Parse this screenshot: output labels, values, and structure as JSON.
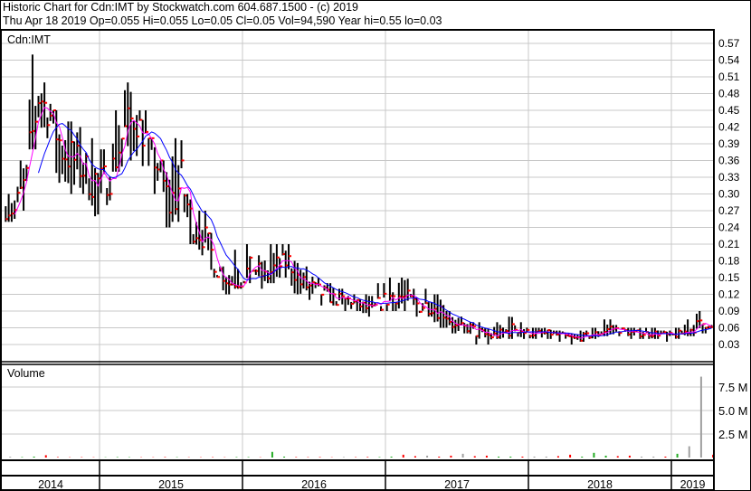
{
  "header": {
    "title": "Historic Chart for Cdn:IMT by Stockwatch.com 604.687.1500 - (c) 2019",
    "quote": "Thu Apr 18 2019  Op=0.055  Hi=0.055  Lo=0.05  Cl=0.05  Vol=94,590  Year hi=0.55  lo=0.03"
  },
  "colors": {
    "bar": "#000000",
    "close_tick": "#ff0000",
    "ma_short": "#ff00ff",
    "ma_long": "#0000ff",
    "grid": "#c8c8c8",
    "vol_up": "#22aa22",
    "vol_down": "#ff0000",
    "vol_flat": "#a0a0a0"
  },
  "chart_data": {
    "type": "bar",
    "subtype": "ohlc",
    "symbol_label": "Cdn:IMT",
    "volume_label": "Volume",
    "price_ticks": [
      "0.03",
      "0.06",
      "0.09",
      "0.12",
      "0.15",
      "0.18",
      "0.21",
      "0.24",
      "0.27",
      "0.30",
      "0.33",
      "0.36",
      "0.39",
      "0.42",
      "0.45",
      "0.48",
      "0.51",
      "0.54",
      "0.57"
    ],
    "price_ylim": [
      0.03,
      0.57
    ],
    "volume_ticks": [
      "2.5 M",
      "5.0 M",
      "7.5 M"
    ],
    "volume_ylim_millions": [
      0,
      7.5
    ],
    "years": [
      "2014",
      "2015",
      "2016",
      "2017",
      "2018",
      "2019"
    ],
    "grid": true,
    "months": [
      "2014-05",
      "2014-06",
      "2014-07",
      "2014-08",
      "2014-09",
      "2014-10",
      "2014-11",
      "2014-12",
      "2015-01",
      "2015-02",
      "2015-03",
      "2015-04",
      "2015-05",
      "2015-06",
      "2015-07",
      "2015-08",
      "2015-09",
      "2015-10",
      "2015-11",
      "2015-12",
      "2016-01",
      "2016-02",
      "2016-03",
      "2016-04",
      "2016-05",
      "2016-06",
      "2016-07",
      "2016-08",
      "2016-09",
      "2016-10",
      "2016-11",
      "2016-12",
      "2017-01",
      "2017-02",
      "2017-03",
      "2017-04",
      "2017-05",
      "2017-06",
      "2017-07",
      "2017-08",
      "2017-09",
      "2017-10",
      "2017-11",
      "2017-12",
      "2018-01",
      "2018-02",
      "2018-03",
      "2018-04",
      "2018-05",
      "2018-06",
      "2018-07",
      "2018-08",
      "2018-09",
      "2018-10",
      "2018-11",
      "2018-12",
      "2019-01",
      "2019-02",
      "2019-03",
      "2019-04"
    ],
    "hlc": [
      [
        0.3,
        0.25,
        0.27
      ],
      [
        0.36,
        0.27,
        0.33
      ],
      [
        0.55,
        0.38,
        0.48
      ],
      [
        0.5,
        0.4,
        0.44
      ],
      [
        0.45,
        0.32,
        0.38
      ],
      [
        0.43,
        0.3,
        0.36
      ],
      [
        0.42,
        0.3,
        0.34
      ],
      [
        0.4,
        0.26,
        0.32
      ],
      [
        0.38,
        0.28,
        0.33
      ],
      [
        0.45,
        0.34,
        0.4
      ],
      [
        0.5,
        0.36,
        0.44
      ],
      [
        0.45,
        0.35,
        0.4
      ],
      [
        0.4,
        0.3,
        0.35
      ],
      [
        0.36,
        0.24,
        0.28
      ],
      [
        0.4,
        0.25,
        0.32
      ],
      [
        0.3,
        0.21,
        0.24
      ],
      [
        0.27,
        0.19,
        0.22
      ],
      [
        0.23,
        0.15,
        0.17
      ],
      [
        0.17,
        0.12,
        0.14
      ],
      [
        0.2,
        0.13,
        0.15
      ],
      [
        0.21,
        0.14,
        0.17
      ],
      [
        0.19,
        0.13,
        0.15
      ],
      [
        0.21,
        0.14,
        0.17
      ],
      [
        0.21,
        0.15,
        0.18
      ],
      [
        0.18,
        0.12,
        0.14
      ],
      [
        0.17,
        0.11,
        0.13
      ],
      [
        0.15,
        0.1,
        0.12
      ],
      [
        0.14,
        0.1,
        0.11
      ],
      [
        0.13,
        0.09,
        0.11
      ],
      [
        0.12,
        0.09,
        0.1
      ],
      [
        0.12,
        0.08,
        0.09
      ],
      [
        0.14,
        0.09,
        0.11
      ],
      [
        0.15,
        0.09,
        0.12
      ],
      [
        0.15,
        0.09,
        0.11
      ],
      [
        0.13,
        0.08,
        0.1
      ],
      [
        0.13,
        0.08,
        0.1
      ],
      [
        0.12,
        0.06,
        0.09
      ],
      [
        0.09,
        0.05,
        0.06
      ],
      [
        0.08,
        0.05,
        0.06
      ],
      [
        0.07,
        0.03,
        0.05
      ],
      [
        0.06,
        0.03,
        0.045
      ],
      [
        0.07,
        0.04,
        0.05
      ],
      [
        0.08,
        0.04,
        0.06
      ],
      [
        0.07,
        0.04,
        0.05
      ],
      [
        0.06,
        0.04,
        0.05
      ],
      [
        0.06,
        0.04,
        0.05
      ],
      [
        0.055,
        0.035,
        0.045
      ],
      [
        0.05,
        0.03,
        0.04
      ],
      [
        0.055,
        0.035,
        0.045
      ],
      [
        0.06,
        0.04,
        0.05
      ],
      [
        0.075,
        0.045,
        0.06
      ],
      [
        0.065,
        0.045,
        0.055
      ],
      [
        0.06,
        0.04,
        0.05
      ],
      [
        0.06,
        0.04,
        0.05
      ],
      [
        0.06,
        0.04,
        0.05
      ],
      [
        0.055,
        0.035,
        0.045
      ],
      [
        0.06,
        0.04,
        0.05
      ],
      [
        0.075,
        0.045,
        0.06
      ],
      [
        0.09,
        0.05,
        0.07
      ],
      [
        0.065,
        0.05,
        0.05
      ]
    ],
    "volume_millions": [
      0.08,
      0.05,
      0.1,
      0.25,
      0.05,
      0.03,
      0.04,
      0.03,
      0.03,
      0.05,
      0.04,
      0.03,
      0.03,
      0.05,
      0.04,
      0.03,
      0.03,
      0.04,
      0.03,
      0.05,
      0.05,
      0.03,
      0.6,
      0.1,
      0.05,
      0.04,
      0.05,
      0.03,
      0.05,
      0.04,
      0.06,
      0.05,
      0.1,
      0.3,
      0.15,
      0.2,
      0.1,
      0.2,
      0.4,
      0.15,
      0.2,
      0.1,
      0.1,
      0.1,
      0.1,
      0.1,
      0.15,
      0.3,
      0.1,
      0.5,
      0.2,
      0.15,
      0.2,
      0.1,
      0.1,
      0.1,
      0.4,
      1.2,
      8.6,
      0.3
    ],
    "moving_averages": [
      "short",
      "long"
    ]
  }
}
